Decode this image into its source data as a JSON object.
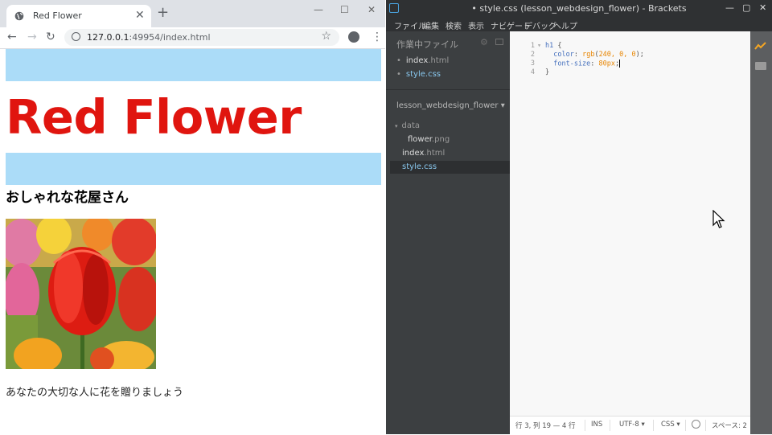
{
  "browser": {
    "tab_title": "Red Flower",
    "tab_close": "✕",
    "new_tab": "+",
    "url_host": "127.0.0.1",
    "url_path": ":49954/index.html",
    "minimize": "—",
    "maximize": "☐",
    "close": "✕",
    "nav_back": "←",
    "nav_forward": "→",
    "nav_reload": "↻",
    "star": "☆",
    "menu": "⋮"
  },
  "page": {
    "h1": "Red Flower",
    "h2": "おしゃれな花屋さん",
    "paragraph": "あなたの大切な人に花を贈りましょう",
    "image_alt": "red tulip flowers",
    "bar_color": "#abdcf8",
    "h1_color": "#e0150f"
  },
  "brackets": {
    "window_title": "• style.css (lesson_webdesign_flower) - Brackets",
    "win_min": "—",
    "win_max": "▢",
    "win_close": "✕",
    "menu": [
      "ファイル",
      "編集",
      "検索",
      "表示",
      "ナビゲート",
      "デバッグ",
      "ヘルプ"
    ],
    "sidebar": {
      "working_files_label": "作業中ファイル",
      "working_files": [
        {
          "name": "index",
          "ext": ".html"
        },
        {
          "name": "style",
          "ext": ".css"
        }
      ],
      "project_name": "lesson_webdesign_flower ▾",
      "tree": {
        "folder": "data",
        "folder_file": {
          "name": "flower",
          "ext": ".png"
        },
        "files": [
          {
            "name": "index",
            "ext": ".html"
          },
          {
            "name": "style",
            "ext": ".css"
          }
        ]
      }
    },
    "editor": {
      "line_numbers": [
        "1",
        "2",
        "3",
        "4"
      ],
      "line1_selector": "h1",
      "line1_brace": " {",
      "line2_prop": "  color",
      "line2_colon": ": ",
      "line2_fn": "rgb",
      "line2_args_open": "(",
      "line2_args": "240, 0, 0",
      "line2_args_close": ");",
      "line3_prop": "  font-size",
      "line3_colon": ": ",
      "line3_value": "80px",
      "line3_end": ";",
      "line4": "}"
    },
    "status": {
      "position": "行 3, 列 19 — 4 行",
      "mode": "INS",
      "encoding": "UTF-8 ▾",
      "language": "CSS ▾",
      "indent": "スペース: 2"
    }
  }
}
